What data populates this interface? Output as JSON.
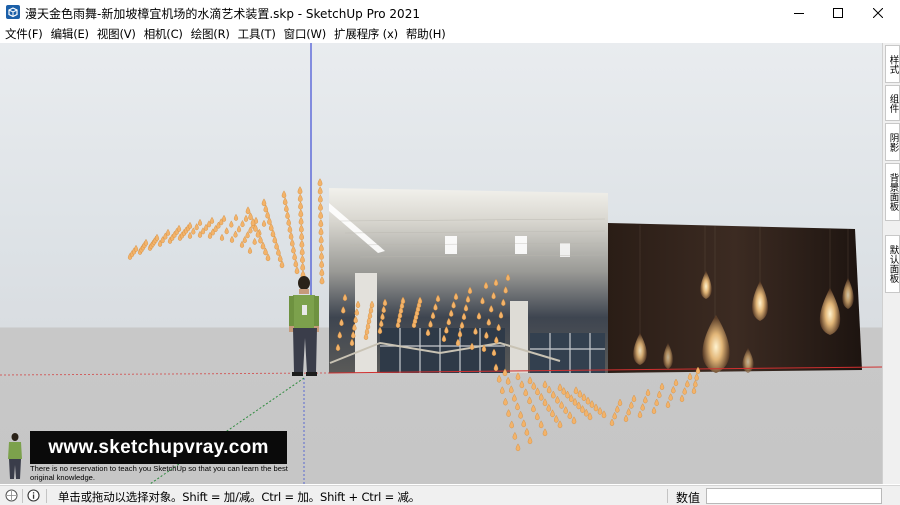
{
  "window": {
    "title": "漫天金色雨舞-新加坡樟宜机场的水滴艺术装置.skp - SketchUp Pro 2021",
    "controls": {
      "minimize": "—",
      "maximize": "☐",
      "close": "✕"
    }
  },
  "menu": [
    "文件(F)",
    "编辑(E)",
    "视图(V)",
    "相机(C)",
    "绘图(R)",
    "工具(T)",
    "窗口(W)",
    "扩展程序 (x)",
    "帮助(H)"
  ],
  "tray_tabs": [
    "样式",
    "组件",
    "阴影",
    "背景面板",
    "默认面板"
  ],
  "watermark": {
    "url": "www.sketchupvray.com",
    "tagline": "There is no reservation to teach you SketchUp so that you can learn the best original knowledge."
  },
  "statusbar": {
    "hint": "单击或拖动以选择对象。Shift = 加/减。Ctrl = 加。Shift + Ctrl = 减。",
    "measure_label": "数值",
    "measure_value": ""
  },
  "icons": {
    "app": "sketchup-logo-icon",
    "geo": "geolocation-icon",
    "info": "info-icon"
  },
  "colors": {
    "accent_blue": "#1565c0",
    "droplet": "#f3b36a",
    "red_axis": "#d03030",
    "green_axis": "#2e8b3e",
    "blue_axis": "#1e2fd0"
  }
}
